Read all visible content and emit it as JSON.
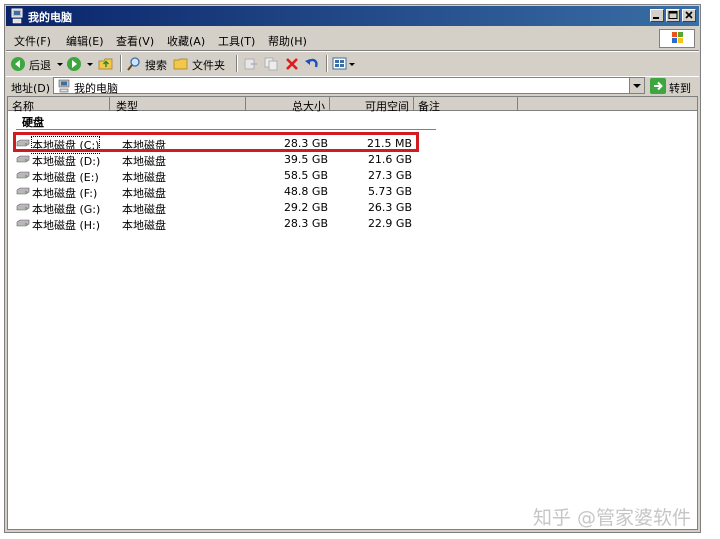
{
  "window": {
    "title": "我的电脑",
    "controls": [
      "minimize-icon",
      "maximize-icon",
      "close-icon"
    ]
  },
  "menu": [
    "文件(F)",
    "编辑(E)",
    "查看(V)",
    "收藏(A)",
    "工具(T)",
    "帮助(H)"
  ],
  "toolbar": {
    "back_label": "后退",
    "search_label": "搜索",
    "folders_label": "文件夹",
    "icons": [
      "back-arrow-icon",
      "forward-arrow-icon",
      "up-folder-icon",
      "search-icon",
      "folders-icon",
      "move-to-icon",
      "copy-to-icon",
      "delete-icon",
      "undo-icon",
      "views-icon"
    ]
  },
  "address": {
    "label": "地址(D)",
    "value": "我的电脑",
    "go_label": "转到"
  },
  "columns": [
    "名称",
    "类型",
    "总大小",
    "可用空间",
    "备注"
  ],
  "group_title": "硬盘",
  "drives": [
    {
      "name": "本地磁盘 (C:)",
      "type": "本地磁盘",
      "total": "28.3 GB",
      "free": "21.5 MB"
    },
    {
      "name": "本地磁盘 (D:)",
      "type": "本地磁盘",
      "total": "39.5 GB",
      "free": "21.6 GB"
    },
    {
      "name": "本地磁盘 (E:)",
      "type": "本地磁盘",
      "total": "58.5 GB",
      "free": "27.3 GB"
    },
    {
      "name": "本地磁盘 (F:)",
      "type": "本地磁盘",
      "total": "48.8 GB",
      "free": "5.73 GB"
    },
    {
      "name": "本地磁盘 (G:)",
      "type": "本地磁盘",
      "total": "29.2 GB",
      "free": "26.3 GB"
    },
    {
      "name": "本地磁盘 (H:)",
      "type": "本地磁盘",
      "total": "28.3 GB",
      "free": "22.9 GB"
    }
  ],
  "highlight_color": "#d01c20",
  "watermark": "知乎 @管家婆软件"
}
